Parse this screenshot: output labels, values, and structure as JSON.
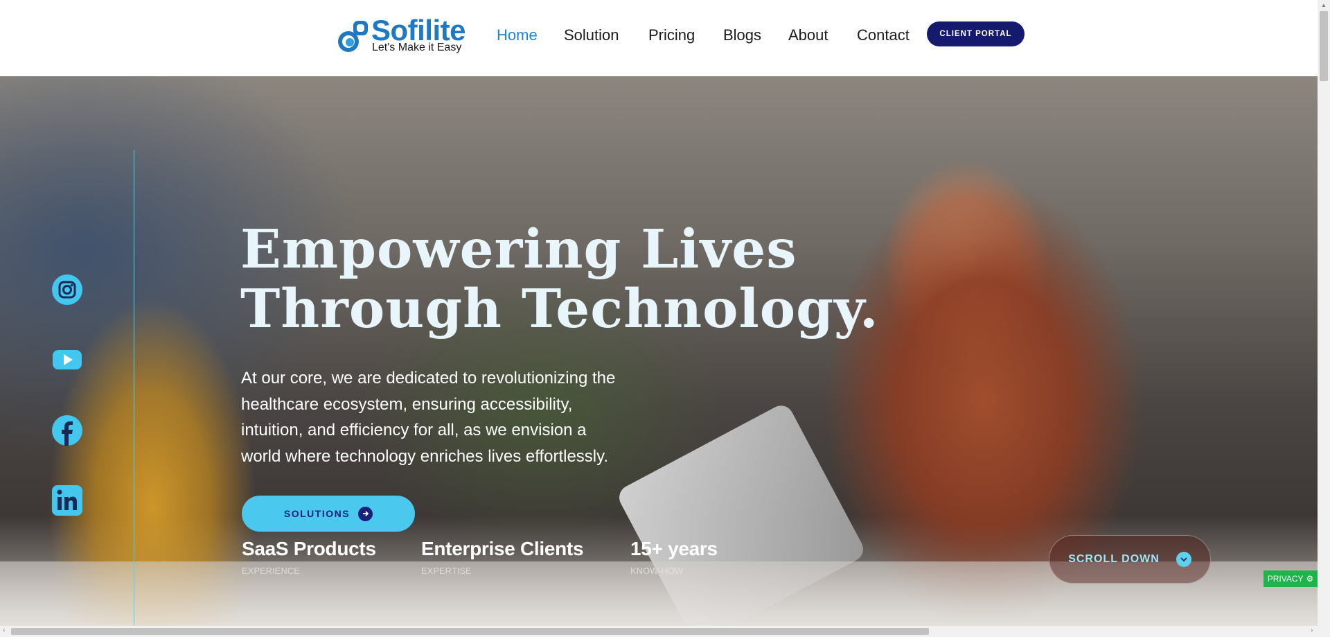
{
  "brand": {
    "name": "Sofilite",
    "tagline": "Let's Make it Easy",
    "color": "#1e78c2"
  },
  "nav": {
    "items": [
      {
        "label": "Home",
        "active": true
      },
      {
        "label": "Solution",
        "active": false
      },
      {
        "label": "Pricing",
        "active": false
      },
      {
        "label": "Blogs",
        "active": false
      },
      {
        "label": "About",
        "active": false
      },
      {
        "label": "Contact",
        "active": false
      }
    ],
    "portal_label": "CLIENT PORTAL"
  },
  "social": [
    "instagram-icon",
    "youtube-icon",
    "facebook-icon",
    "linkedin-icon"
  ],
  "hero": {
    "headline_line1": "Empowering Lives",
    "headline_line2": "Through Technology.",
    "lead": "At our core, we are dedicated to revolutionizing the healthcare ecosystem, ensuring accessibility, intuition, and efficiency for all, as we envision a world where technology enriches lives effortlessly.",
    "cta_label": "SOLUTIONS",
    "stats": [
      {
        "title": "SaaS Products",
        "sub": "EXPERIENCE"
      },
      {
        "title": "Enterprise Clients",
        "sub": "EXPERTISE"
      },
      {
        "title": "15+ years",
        "sub": "KNOW-HOW"
      }
    ],
    "scroll_label": "SCROLL DOWN"
  },
  "privacy_label": "PRIVACY",
  "colors": {
    "accent": "#4ac8ee",
    "navy": "#161a6f",
    "active_nav": "#1c86d1",
    "privacy": "#1fb44a"
  }
}
